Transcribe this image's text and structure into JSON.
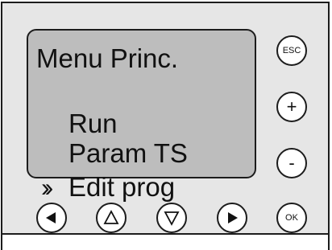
{
  "menu": {
    "title": "Menu Princ.",
    "items": [
      {
        "label": "Run"
      },
      {
        "label": "Param TS"
      },
      {
        "label": "Edit prog"
      }
    ],
    "selected_index": 2,
    "cursor_symbol": "››"
  },
  "buttons": {
    "esc": {
      "label": "ESC"
    },
    "plus": {
      "label": "+"
    },
    "minus": {
      "label": "-"
    },
    "ok": {
      "label": "OK"
    },
    "left": {
      "icon": "arrow-left-filled-icon"
    },
    "up": {
      "icon": "arrow-up-outline-icon"
    },
    "down": {
      "icon": "arrow-down-outline-icon"
    },
    "right": {
      "icon": "arrow-right-filled-icon"
    }
  },
  "colors": {
    "panel": "#e6e6e6",
    "lcd": "#bdbdbd",
    "outline": "#1c1c1c",
    "button_face": "#ffffff"
  }
}
